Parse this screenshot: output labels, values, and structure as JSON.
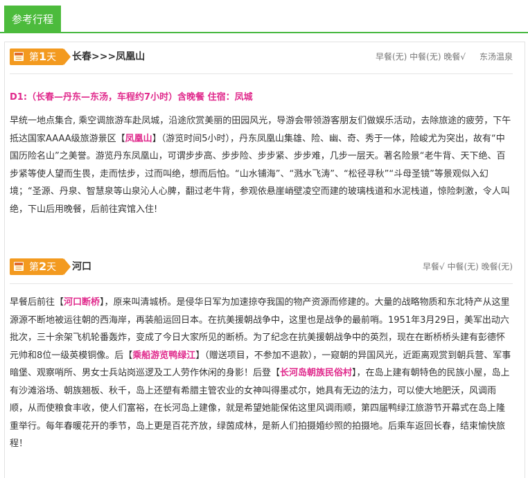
{
  "tab": {
    "label": "参考行程"
  },
  "days": [
    {
      "prefix": "第",
      "num": "1",
      "suffix": "天",
      "route": "长春>>>凤凰山",
      "meals": "早餐(无) 中餐(无) 晚餐√",
      "hotel": "东汤温泉",
      "title": "D1:（长春—丹东—东汤，车程约7小时）含晚餐 住宿：凤城",
      "desc": {
        "p1": "早统一地点集合, 乘空调旅游车赴凤城，沿途欣赏美丽的田园风光，导游会带领游客朋友们做娱乐活动，去除旅途的疲劳，下午抵达国家AAAA级旅游景区【",
        "hl1": "凤凰山",
        "p2": "】（游览时间5小时），丹东凤凰山集雄、险、幽、奇、秀于一体，险峻尤为突出，故有“中国历险名山”之美誉。游览丹东凤凰山，可谓步步高、步步险、步步紧、步步难，几步一层天。著名险景“老牛背、天下绝、百步紧等使人望而生畏，走而怯步，过而叫绝，想而后怕。“山水铺海”、“溅水飞涛”、“松径寻秋”“斗母圣镜”等景观似入幻境；“圣源、丹泉、智慧泉等山泉沁人心脾，翻过老牛背，参观依悬崖峭壁凌空而建的玻璃栈道和水泥栈道，惊险刺激，令人叫绝，下山后用晚餐，后前往宾馆入住!"
      }
    },
    {
      "prefix": "第",
      "num": "2",
      "suffix": "天",
      "route": "河口",
      "meals": "早餐√ 中餐(无) 晚餐(无)",
      "desc": {
        "p1": "早餐后前往【",
        "hl1": "河口断桥",
        "p2": "】，原来叫清城桥。是侵华日军为加速掠夺我国的物产资源而修建的。大量的战略物质和东北特产从这里源源不断地被运往朝的西海岸，再装船运回日本。在抗美援朝战争中，这里也是战争的最前哨。1951年3月29日，美军出动六批次，三十余架飞机轮番轰炸，变成了今日大家所见的断桥。为了纪念在抗美援朝战争中的英烈，现在在断桥桥头建有彭德怀元帅和8位一级英模铜像。后【",
        "hl2": "乘船游览鸭绿江",
        "p3": "】（赠送项目，不参加不退款），一窥朝的异国风光，近距离观赏到朝兵营、军事暗堡、观察哨所、男女士兵站岗巡逻及工人劳作休闲的身影！后登【",
        "hl3": "长河岛朝族民俗村",
        "p4": "】，在岛上建有朝特色的民族小屋，岛上有沙滩浴场、朝族翘板、秋千，岛上还塑有希腊主管农业的女神叫得墨忒尔，她具有无边的法力，可以使大地肥沃，风调雨顺，从而使粮食丰收，使人们富裕，在长河岛上建像，就是希望她能保佑这里风调雨顺，第四届鸭绿江旅游节开幕式在岛上隆重举行。每年春暖花开的季节，岛上更是百花齐放，绿茵成林，是新人们拍摄婚纱照的拍摄地。后乘车返回长春，结束愉快旅程！"
      }
    }
  ]
}
